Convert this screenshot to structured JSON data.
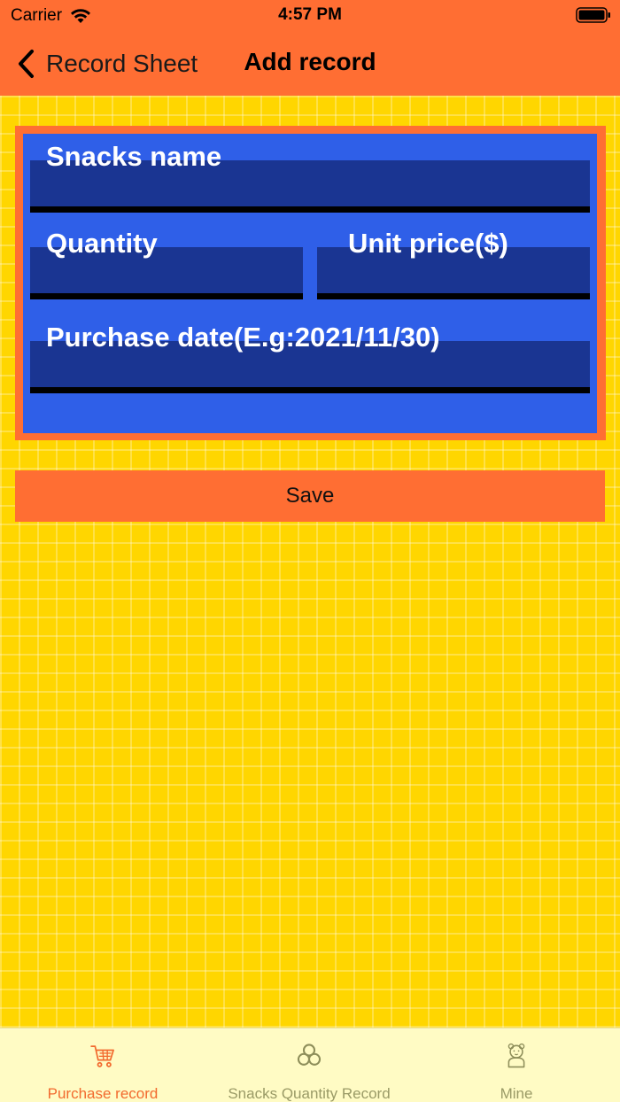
{
  "status_bar": {
    "carrier": "Carrier",
    "time": "4:57 PM"
  },
  "nav": {
    "back_label": "Record Sheet",
    "title": "Add record"
  },
  "form": {
    "snacks_name_label": "Snacks name",
    "snacks_name_value": "",
    "quantity_label": "Quantity",
    "quantity_value": "",
    "unit_price_label": "Unit price($)",
    "unit_price_value": "",
    "purchase_date_label": "Purchase date(E.g:2021/11/30)",
    "purchase_date_value": ""
  },
  "save_label": "Save",
  "tabs": [
    {
      "label": "Purchase record",
      "icon": "cart-icon",
      "active": true
    },
    {
      "label": "Snacks Quantity Record",
      "icon": "circles-icon",
      "active": false
    },
    {
      "label": "Mine",
      "icon": "bear-icon",
      "active": false
    }
  ],
  "colors": {
    "accent": "#FF6E33",
    "background": "#FFD600",
    "form_blue": "#2F5FE8",
    "input_blue": "#1A3592",
    "tab_active": "#F26A2E",
    "tab_inactive": "#9A9A66"
  }
}
